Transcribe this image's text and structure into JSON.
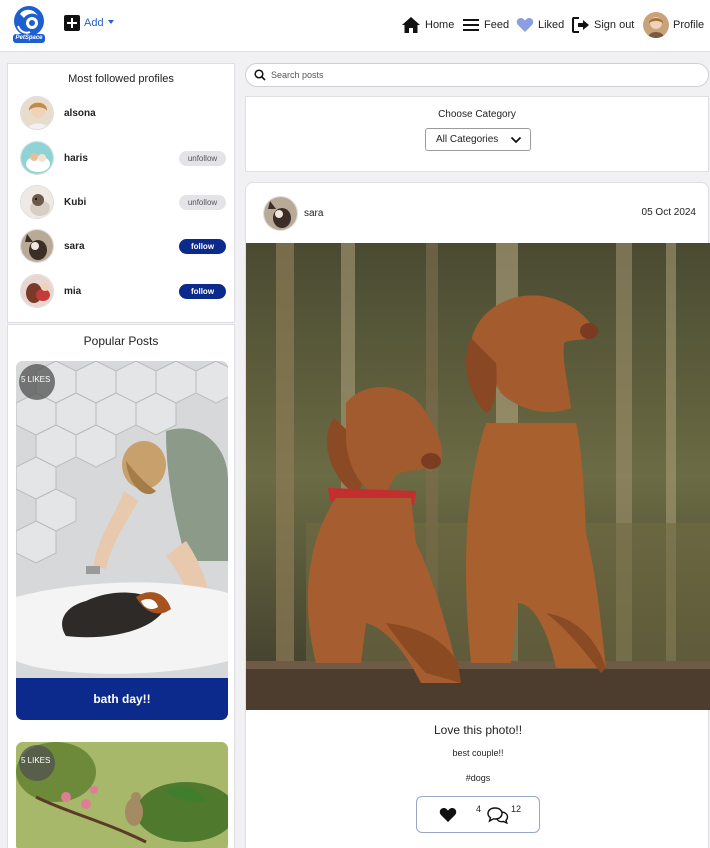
{
  "app": {
    "logo_text": "PetSpace"
  },
  "nav": {
    "add_label": "Add",
    "home_label": "Home",
    "feed_label": "Feed",
    "liked_label": "Liked",
    "signout_label": "Sign out",
    "profile_label": "Profile"
  },
  "sidebar": {
    "most_followed_title": "Most followed profiles",
    "profiles": [
      {
        "name": "alsona",
        "action": ""
      },
      {
        "name": "haris",
        "action": "unfollow"
      },
      {
        "name": "Kubi",
        "action": "unfollow"
      },
      {
        "name": "sara",
        "action": "follow"
      },
      {
        "name": "mia",
        "action": "follow"
      }
    ],
    "popular_title": "Popular Posts",
    "popular_posts": [
      {
        "likes": "5 LIKES",
        "title": "bath day!!"
      },
      {
        "likes": "5 LIKES",
        "title": ""
      }
    ]
  },
  "search": {
    "placeholder": "Search posts"
  },
  "category": {
    "label": "Choose Category",
    "selected": "All Categories"
  },
  "post": {
    "user": "sara",
    "date": "05 Oct 2024",
    "title": "Love this photo!!",
    "description": "best couple!!",
    "tag": "#dogs",
    "likes": "4",
    "comments": "12"
  },
  "colors": {
    "brand_blue": "#0b2a8c",
    "link_blue": "#2a5fc4",
    "liked_heart": "#8a9fe0"
  }
}
